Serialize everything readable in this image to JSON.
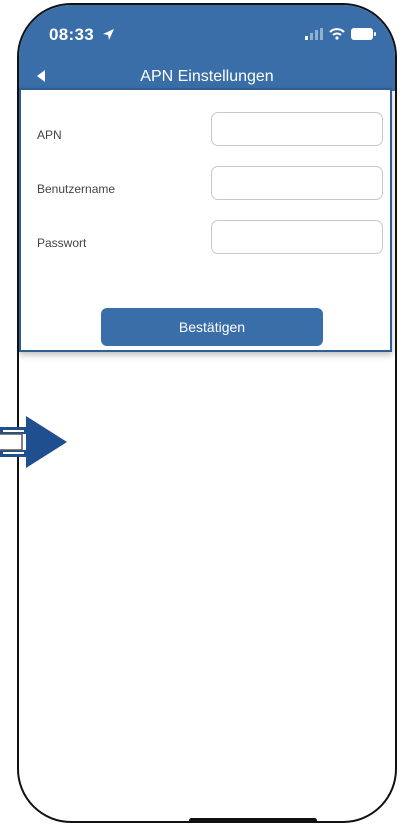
{
  "status_bar": {
    "time": "08:33"
  },
  "nav": {
    "title": "APN Einstellungen"
  },
  "form": {
    "apn_label": "APN",
    "username_label": "Benutzername",
    "password_label": "Passwort",
    "apn_value": "",
    "username_value": "",
    "password_value": ""
  },
  "confirm_button": {
    "label": "Bestätigen"
  },
  "colors": {
    "primary": "#3a6ea8",
    "arrow": "#1f4f8f"
  },
  "icons": [
    "location-arrow-icon",
    "cellular-signal-icon",
    "wifi-icon",
    "battery-icon",
    "back-arrow-icon",
    "pointer-arrow-icon"
  ]
}
